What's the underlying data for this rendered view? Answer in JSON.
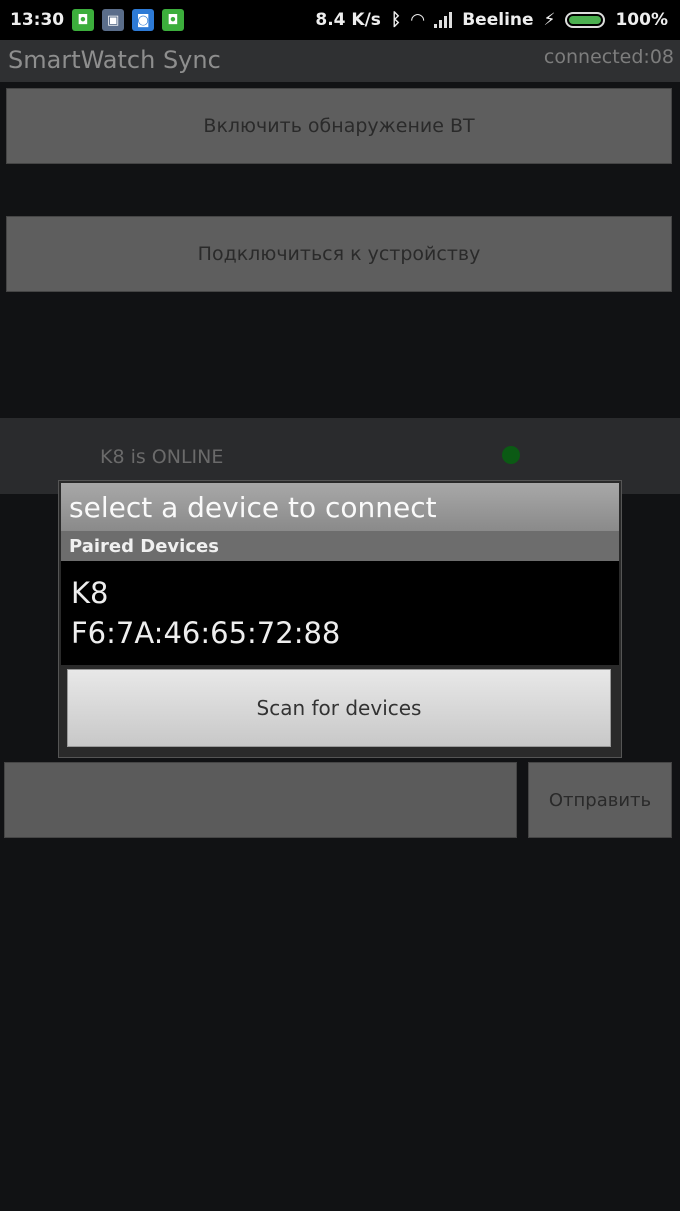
{
  "status_bar": {
    "time": "13:30",
    "notifications": [
      {
        "icon": "app-notification-icon",
        "color": "#3cae3c"
      },
      {
        "icon": "gallery-notification-icon",
        "color": "#5a6d8a"
      },
      {
        "icon": "messenger-notification-icon",
        "color": "#2d7ad6"
      },
      {
        "icon": "app-notification-icon",
        "color": "#3cae3c"
      }
    ],
    "net_speed": "8.4 K/s",
    "carrier": "Beeline",
    "battery_percent": "100%"
  },
  "app": {
    "title": "SmartWatch Sync",
    "connection_status": "connected:08"
  },
  "buttons": {
    "enable_discovery": "Включить обнаружение BT",
    "connect_device": "Подключиться к устройству",
    "send": "Отправить"
  },
  "device_status": {
    "text": "K8 is ONLINE",
    "indicator_color": "#0b5a14"
  },
  "message_input": {
    "value": ""
  },
  "dialog": {
    "title": "select a device to connect",
    "section_header": "Paired Devices",
    "devices": [
      {
        "name": "K8",
        "address": "F6:7A:46:65:72:88"
      }
    ],
    "scan_button": "Scan for devices"
  }
}
